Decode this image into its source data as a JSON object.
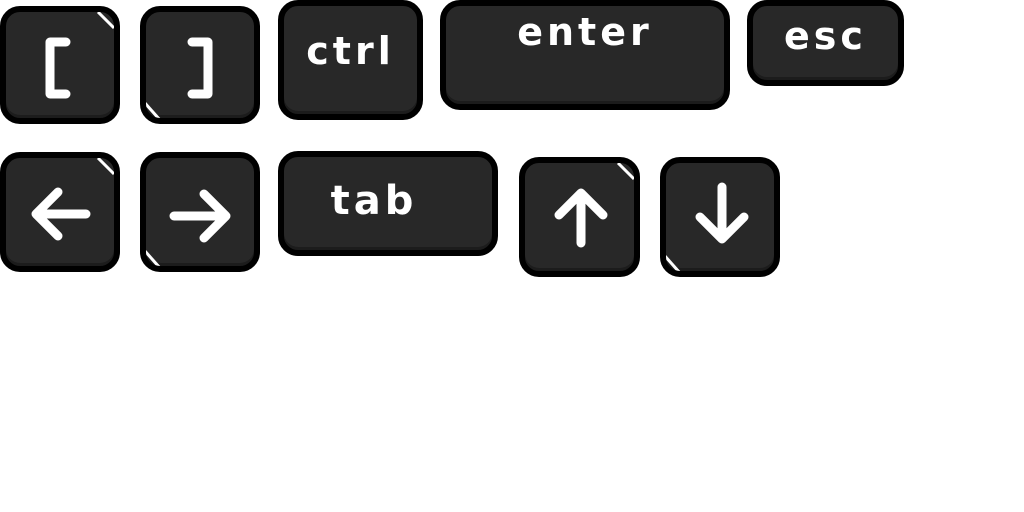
{
  "keys": {
    "bracket_left": {
      "label": "["
    },
    "bracket_right": {
      "label": "]"
    },
    "ctrl": {
      "label": "ctrl"
    },
    "enter": {
      "label": "enter"
    },
    "esc": {
      "label": "esc"
    },
    "arrow_left": {
      "icon": "arrow-left-icon"
    },
    "arrow_right": {
      "icon": "arrow-right-icon"
    },
    "tab": {
      "label": "tab"
    },
    "arrow_up": {
      "icon": "arrow-up-icon"
    },
    "arrow_down": {
      "icon": "arrow-down-icon"
    }
  },
  "colors": {
    "key_face": "#282828",
    "key_border": "#000000",
    "glyph": "#ffffff",
    "background": "#ffffff"
  }
}
